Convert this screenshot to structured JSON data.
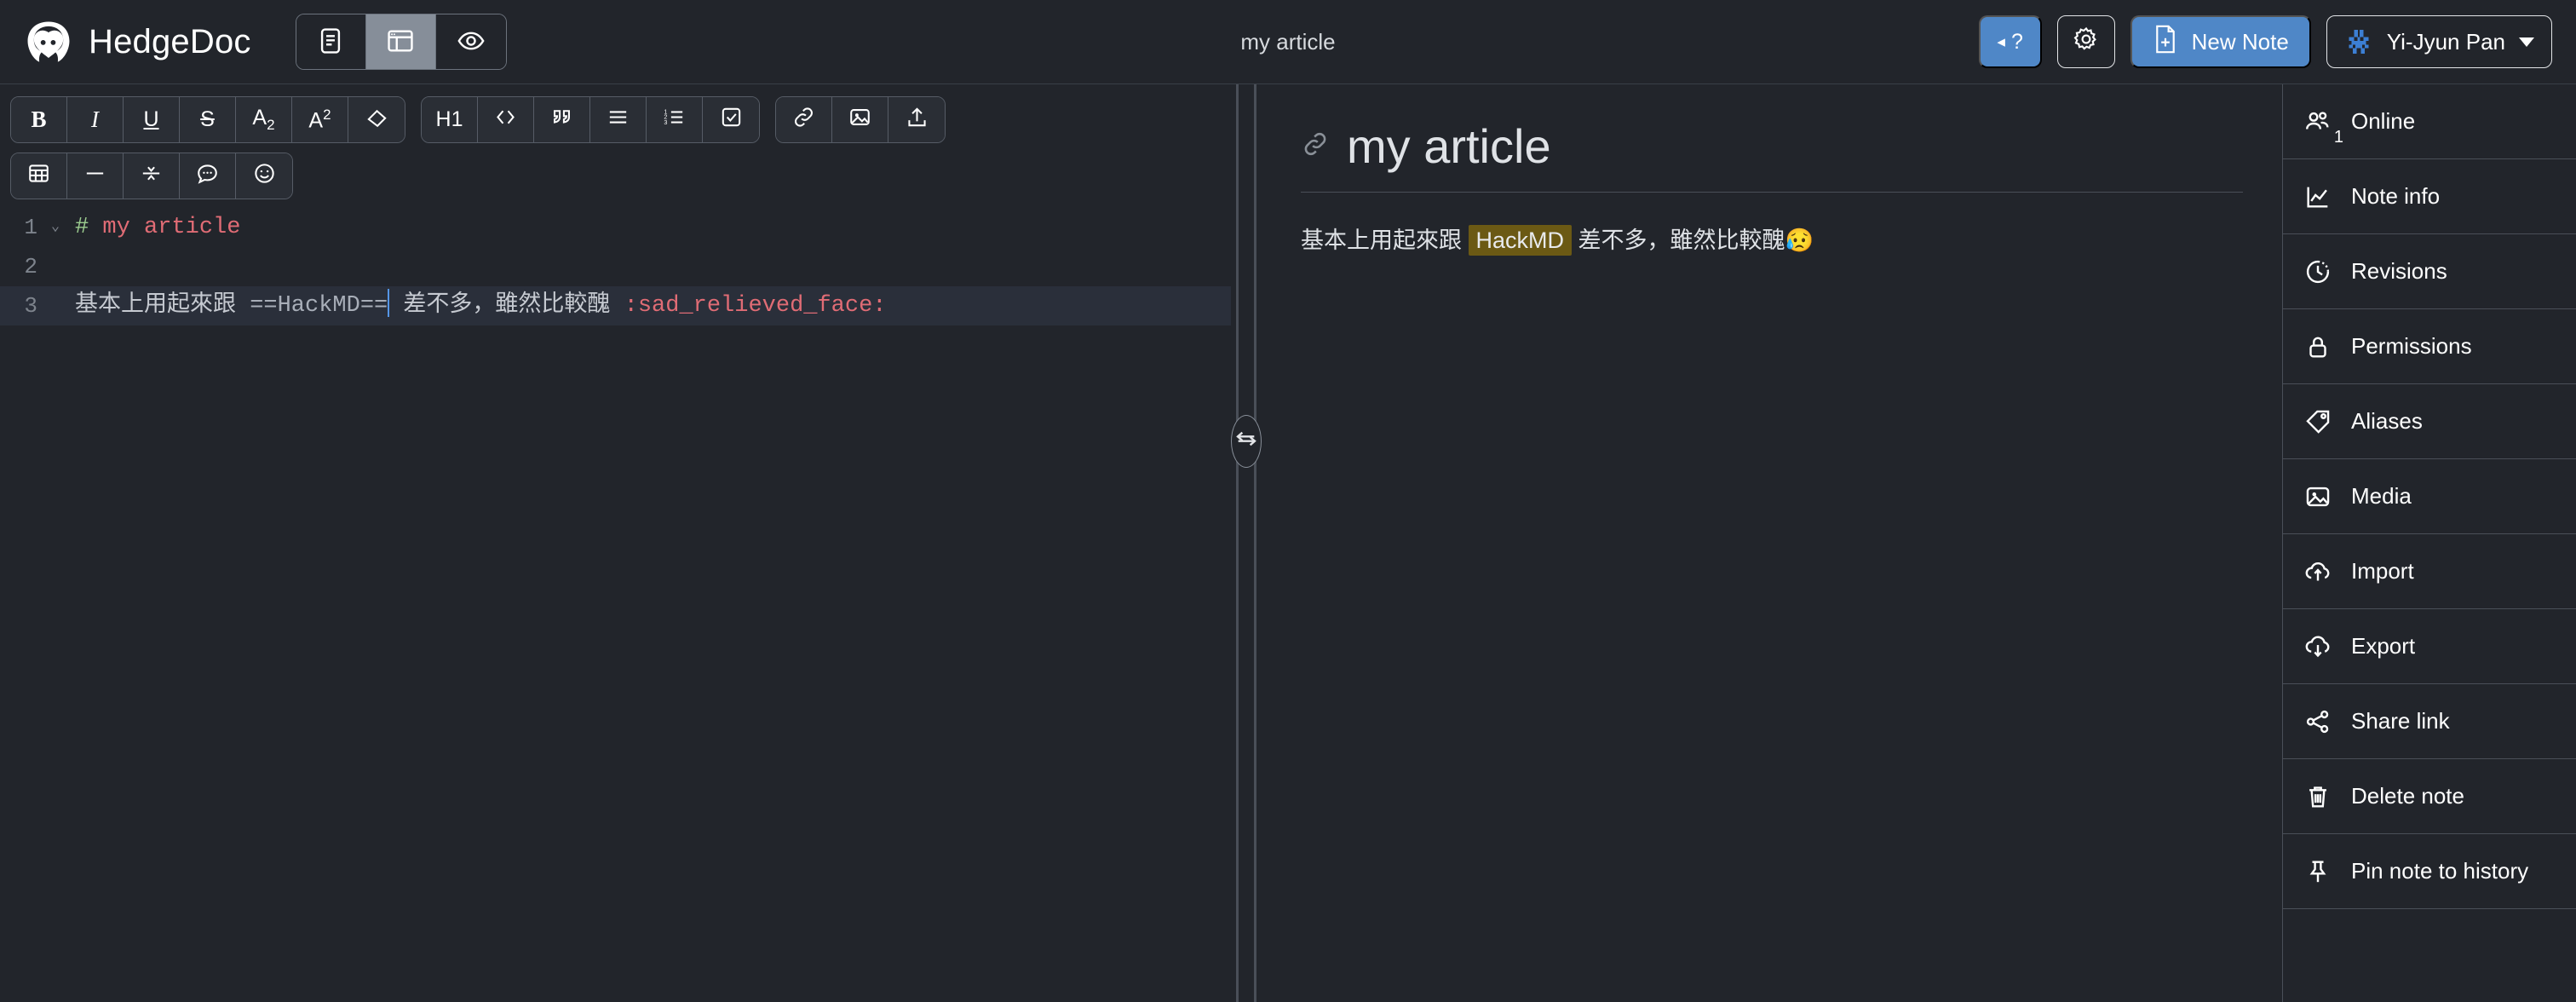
{
  "header": {
    "brand": "HedgeDoc",
    "note_title": "my article",
    "view_modes": [
      {
        "name": "view-mode-editor",
        "icon": "document-icon",
        "active": false
      },
      {
        "name": "view-mode-both",
        "icon": "split-view-icon",
        "active": true
      },
      {
        "name": "view-mode-preview",
        "icon": "eye-icon",
        "active": false
      }
    ],
    "help_label": "?",
    "help_caret": "◂",
    "settings_icon": "gear-icon",
    "new_note_label": "New Note",
    "user_name": "Yi-Jyun Pan"
  },
  "toolbar": {
    "row1": [
      {
        "label": "B",
        "name": "bold-button",
        "style": "bold"
      },
      {
        "label": "I",
        "name": "italic-button",
        "style": "italic"
      },
      {
        "label": "U",
        "name": "underline-button",
        "style": "underline"
      },
      {
        "label": "S",
        "name": "strikethrough-button",
        "style": "strike"
      },
      {
        "label": "A₂",
        "name": "subscript-button",
        "style": "plain"
      },
      {
        "label": "A²",
        "name": "superscript-button",
        "style": "plain"
      },
      {
        "label": "",
        "name": "highlight-button",
        "style": "icon-highlight"
      }
    ],
    "row1b": [
      {
        "label": "H1",
        "name": "header-button",
        "style": "sans"
      },
      {
        "label": "<>",
        "name": "code-button",
        "style": "icon-code"
      },
      {
        "label": "“",
        "name": "blockquote-button",
        "style": "icon-quote"
      },
      {
        "label": "",
        "name": "unordered-list-button",
        "style": "icon-ul"
      },
      {
        "label": "",
        "name": "ordered-list-button",
        "style": "icon-ol"
      },
      {
        "label": "",
        "name": "check-list-button",
        "style": "icon-check"
      }
    ],
    "row1c": [
      {
        "label": "",
        "name": "link-button",
        "style": "icon-link"
      },
      {
        "label": "",
        "name": "image-button",
        "style": "icon-image"
      },
      {
        "label": "",
        "name": "upload-button",
        "style": "icon-upload"
      }
    ],
    "row2": [
      {
        "label": "",
        "name": "table-button",
        "style": "icon-table"
      },
      {
        "label": "",
        "name": "horizontal-line-button",
        "style": "icon-hr"
      },
      {
        "label": "",
        "name": "collapsible-block-button",
        "style": "icon-collapse"
      },
      {
        "label": "",
        "name": "comment-button",
        "style": "icon-comment"
      },
      {
        "label": "",
        "name": "emoji-button",
        "style": "icon-emoji"
      }
    ]
  },
  "editor": {
    "lines": [
      {
        "number": "1",
        "foldable": true,
        "active": false,
        "tokens": [
          {
            "text": "# ",
            "cls": "tok-hash"
          },
          {
            "text": "my article",
            "cls": "tok-head"
          }
        ]
      },
      {
        "number": "2",
        "foldable": false,
        "active": false,
        "tokens": []
      },
      {
        "number": "3",
        "foldable": false,
        "active": true,
        "tokens": [
          {
            "text": "基本上用起來跟 ",
            "cls": ""
          },
          {
            "text": "==HackMD==",
            "cls": "tok-mark"
          },
          {
            "text": "CARET",
            "cls": "caret"
          },
          {
            "text": " 差不多，雖然比較醜 ",
            "cls": ""
          },
          {
            "text": ":sad_relieved_face:",
            "cls": "tok-emoji-code"
          }
        ]
      }
    ]
  },
  "preview": {
    "heading": "my article",
    "anchor_icon": "link-icon",
    "paragraph": {
      "before": "基本上用起來跟 ",
      "highlight": "HackMD",
      "after": " 差不多，雖然比較醜",
      "emoji": "😥"
    }
  },
  "sidebar": {
    "items": [
      {
        "label": "Online",
        "icon": "users-icon",
        "badge": "1"
      },
      {
        "label": "Note info",
        "icon": "chart-line-icon",
        "badge": ""
      },
      {
        "label": "Revisions",
        "icon": "clock-history-icon",
        "badge": ""
      },
      {
        "label": "Permissions",
        "icon": "lock-icon",
        "badge": ""
      },
      {
        "label": "Aliases",
        "icon": "tag-icon",
        "badge": ""
      },
      {
        "label": "Media",
        "icon": "image-icon",
        "badge": ""
      },
      {
        "label": "Import",
        "icon": "cloud-upload-icon",
        "badge": ""
      },
      {
        "label": "Export",
        "icon": "cloud-download-icon",
        "badge": ""
      },
      {
        "label": "Share link",
        "icon": "share-icon",
        "badge": ""
      },
      {
        "label": "Delete note",
        "icon": "trash-icon",
        "badge": ""
      },
      {
        "label": "Pin note to history",
        "icon": "pin-icon",
        "badge": ""
      }
    ]
  },
  "colors": {
    "background": "#22252b",
    "accent_blue": "#4f87c7",
    "highlight_mark": "#6b5914",
    "heading_token": "#e06c75",
    "hash_token": "#9ccc8f",
    "caret": "#5596e6"
  }
}
